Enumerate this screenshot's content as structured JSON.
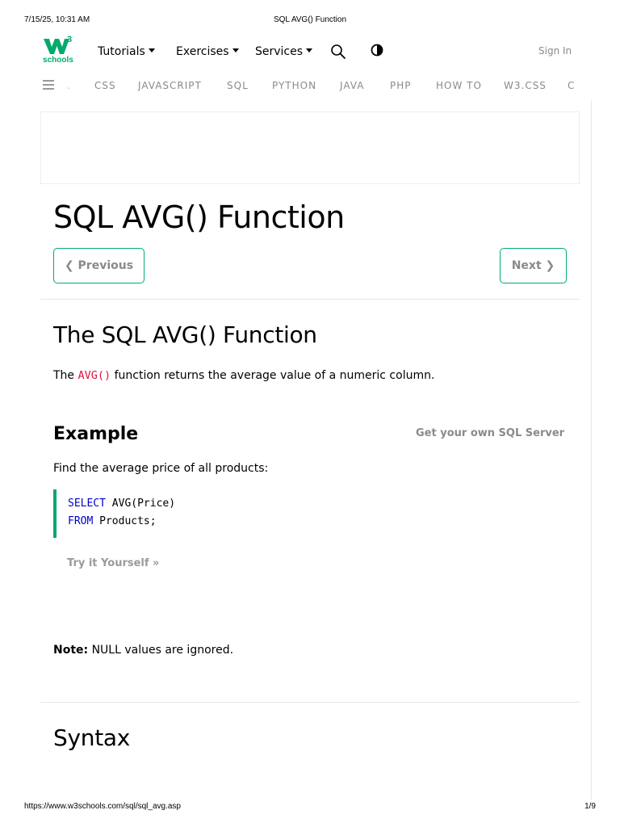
{
  "print": {
    "date": "7/15/25, 10:31 AM",
    "title": "SQL AVG() Function",
    "url": "https://www.w3schools.com/sql/sql_avg.asp",
    "page": "1/9"
  },
  "header": {
    "logo_text": "schools",
    "logo_superscript": "3",
    "nav": [
      {
        "label": "Tutorials"
      },
      {
        "label": "Exercises"
      },
      {
        "label": "Services"
      }
    ],
    "icons": [
      "search-icon",
      "contrast-icon"
    ],
    "signin_label": "Sign In"
  },
  "subnav": {
    "items": [
      "CSS",
      "JAVASCRIPT",
      "SQL",
      "PYTHON",
      "JAVA",
      "PHP",
      "HOW TO",
      "W3.CSS",
      "C"
    ]
  },
  "main": {
    "title": "SQL AVG() Function",
    "prev_label": "Previous",
    "next_label": "Next",
    "section1": {
      "heading": "The SQL AVG() Function",
      "text_before": "The",
      "code": "AVG()",
      "text_after": "function returns the average value of a numeric column."
    },
    "example": {
      "heading": "Example",
      "server_link": "Get your own SQL Server",
      "description": "Find the average price of all products:",
      "code_lines": [
        {
          "keyword": "SELECT",
          "rest": " AVG(Price)"
        },
        {
          "keyword": "FROM",
          "rest": " Products;"
        }
      ],
      "try_label": "Try it Yourself »"
    },
    "note": {
      "label": "Note:",
      "text": "NULL values are ignored."
    },
    "syntax_heading": "Syntax"
  },
  "colors": {
    "brand": "#04AA6D",
    "muted": "#8a8a8a",
    "inline_code": "#dc143c",
    "keyword": "#0000cd"
  }
}
